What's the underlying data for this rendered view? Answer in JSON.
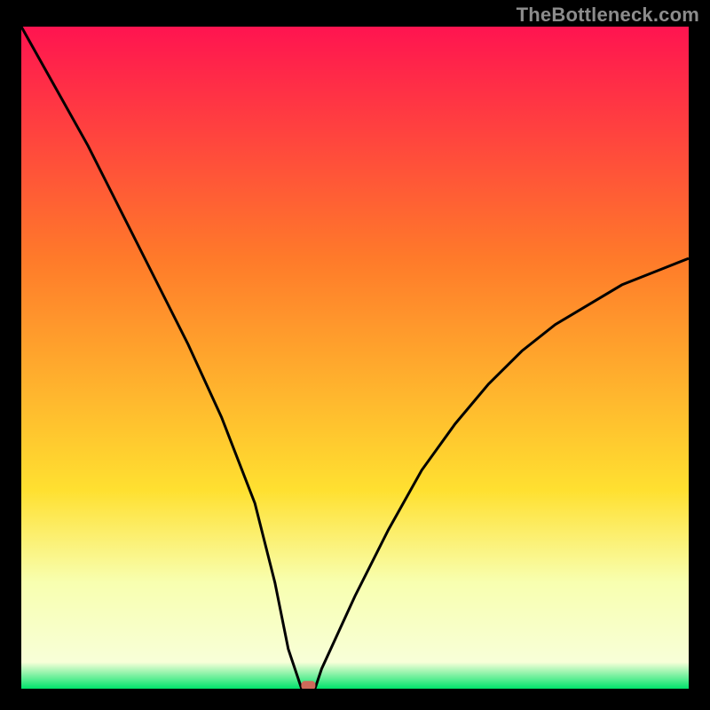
{
  "watermark": "TheBottleneck.com",
  "colors": {
    "black": "#000000",
    "gray": "#8c8c8c",
    "gradient_top": "#ff1450",
    "gradient_mid1": "#ff7a2a",
    "gradient_mid2": "#ffe030",
    "gradient_low": "#f8ffb0",
    "gradient_bottom": "#00e36b",
    "curve": "#000000",
    "dot": "#cf6a5a"
  },
  "chart_data": {
    "type": "line",
    "title": "",
    "xlabel": "",
    "ylabel": "",
    "xlim": [
      0,
      100
    ],
    "ylim": [
      0,
      100
    ],
    "series": [
      {
        "name": "bottleneck-curve",
        "x": [
          0,
          5,
          10,
          15,
          20,
          25,
          30,
          35,
          38,
          40,
          42,
          44,
          45,
          50,
          55,
          60,
          65,
          70,
          75,
          80,
          85,
          90,
          95,
          100
        ],
        "y": [
          100,
          91,
          82,
          72,
          62,
          52,
          41,
          28,
          16,
          6,
          0,
          0,
          3,
          14,
          24,
          33,
          40,
          46,
          51,
          55,
          58,
          61,
          63,
          65
        ]
      }
    ],
    "marker": {
      "x": 43,
      "y": 0.5
    },
    "gradient_stops": [
      {
        "pct": 0,
        "color": "#ff1450"
      },
      {
        "pct": 35,
        "color": "#ff7a2a"
      },
      {
        "pct": 70,
        "color": "#ffe030"
      },
      {
        "pct": 84,
        "color": "#f8ffb0"
      },
      {
        "pct": 96,
        "color": "#f8ffd8"
      },
      {
        "pct": 100,
        "color": "#00e36b"
      }
    ]
  }
}
